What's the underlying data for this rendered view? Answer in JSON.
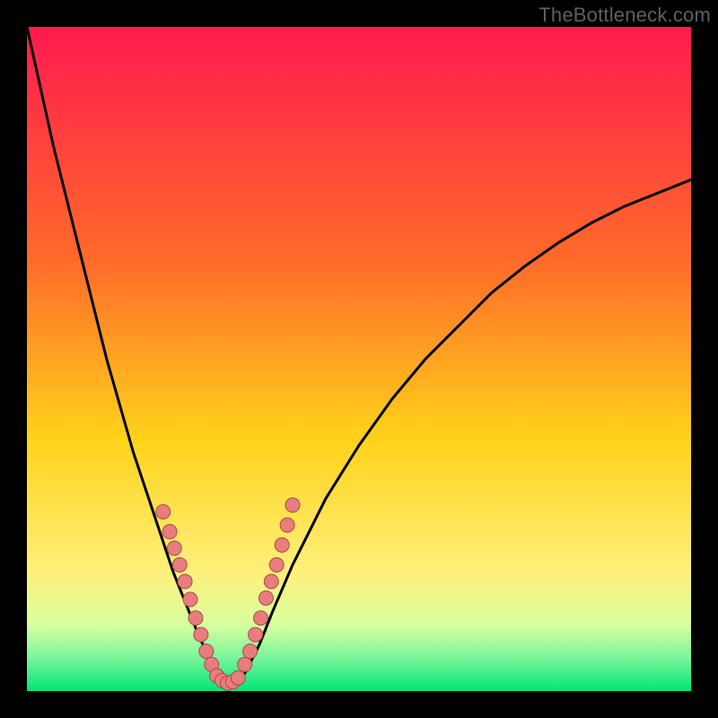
{
  "watermark": "TheBottleneck.com",
  "colors": {
    "gradient_top": "#ff1a4f",
    "gradient_mid1": "#ff6a2a",
    "gradient_mid2": "#ffd21a",
    "gradient_mid3": "#fff07a",
    "gradient_bottom_band1": "#d8ffa0",
    "gradient_bottom_band2": "#79f59a",
    "gradient_bottom_band3": "#00e676",
    "curve": "#000000",
    "dot_fill": "#e77d7d",
    "dot_stroke": "#a84b4b",
    "frame": "#000000"
  },
  "chart_data": {
    "type": "line",
    "title": "",
    "xlabel": "",
    "ylabel": "",
    "xlim": [
      0,
      100
    ],
    "ylim": [
      0,
      100
    ],
    "series": [
      {
        "name": "bottleneck-curve",
        "x": [
          0,
          2,
          4,
          6,
          8,
          10,
          12,
          14,
          16,
          18,
          20,
          22,
          24,
          26,
          27,
          28,
          29,
          30,
          31,
          32,
          33,
          35,
          37,
          40,
          45,
          50,
          55,
          60,
          65,
          70,
          75,
          80,
          85,
          90,
          95,
          100
        ],
        "y": [
          100,
          91,
          82,
          74,
          66,
          58,
          50,
          43,
          36,
          30,
          24,
          18,
          13,
          8,
          6,
          4,
          2.5,
          1.5,
          1,
          1.5,
          3,
          7,
          12,
          19,
          29,
          37,
          44,
          50,
          55,
          60,
          64,
          67.5,
          70.5,
          73,
          75,
          77
        ]
      }
    ],
    "dots_left": {
      "name": "left-branch-samples",
      "points": [
        {
          "x": 20.5,
          "y": 27
        },
        {
          "x": 21.5,
          "y": 24
        },
        {
          "x": 22.2,
          "y": 21.5
        },
        {
          "x": 23.0,
          "y": 19
        },
        {
          "x": 23.8,
          "y": 16.5
        },
        {
          "x": 24.6,
          "y": 13.8
        },
        {
          "x": 25.4,
          "y": 11
        },
        {
          "x": 26.2,
          "y": 8.5
        },
        {
          "x": 27.0,
          "y": 6
        },
        {
          "x": 27.8,
          "y": 4
        }
      ]
    },
    "dots_right": {
      "name": "right-branch-samples",
      "points": [
        {
          "x": 32.8,
          "y": 4
        },
        {
          "x": 33.6,
          "y": 6
        },
        {
          "x": 34.4,
          "y": 8.5
        },
        {
          "x": 35.2,
          "y": 11
        },
        {
          "x": 36.0,
          "y": 14
        },
        {
          "x": 36.8,
          "y": 16.5
        },
        {
          "x": 37.6,
          "y": 19
        },
        {
          "x": 38.4,
          "y": 22
        },
        {
          "x": 39.2,
          "y": 25
        },
        {
          "x": 40.0,
          "y": 28
        }
      ]
    },
    "dots_bottom": {
      "name": "valley-samples",
      "points": [
        {
          "x": 28.6,
          "y": 2.3
        },
        {
          "x": 29.4,
          "y": 1.6
        },
        {
          "x": 30.2,
          "y": 1.2
        },
        {
          "x": 31.0,
          "y": 1.4
        },
        {
          "x": 31.8,
          "y": 2.0
        }
      ]
    }
  }
}
